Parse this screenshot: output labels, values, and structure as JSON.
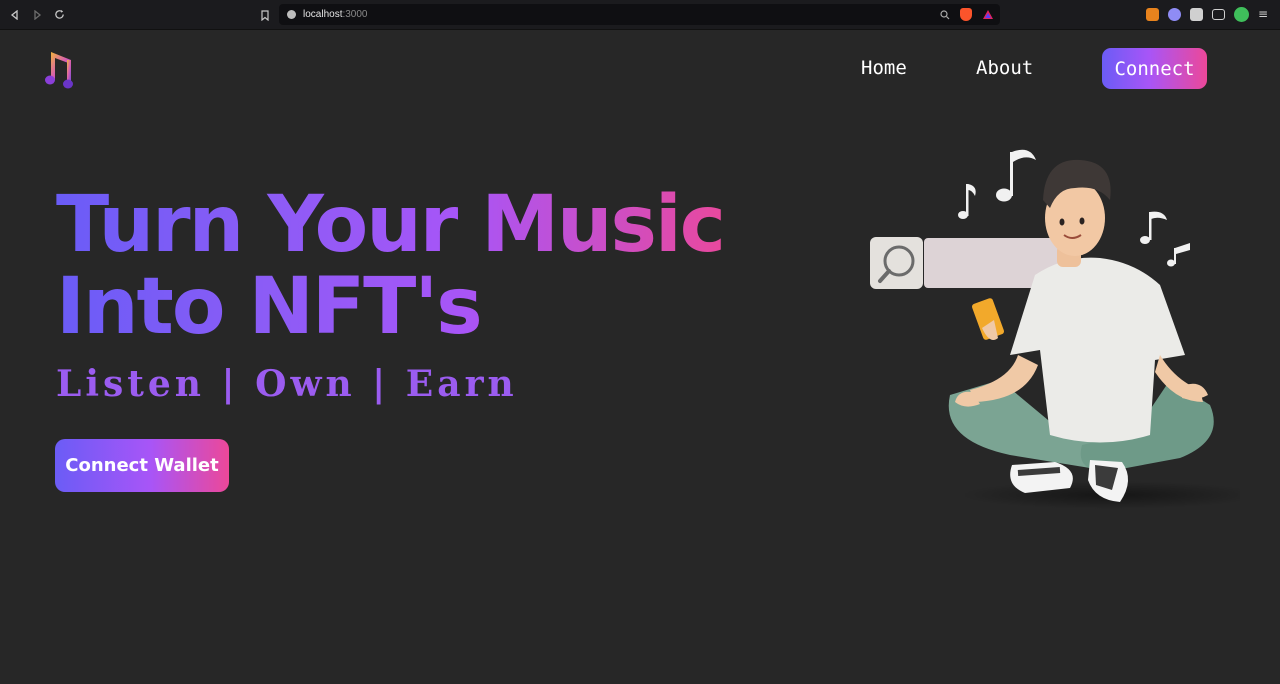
{
  "browser": {
    "url_host": "localhost",
    "url_port": ":3000"
  },
  "nav": {
    "home": "Home",
    "about": "About",
    "connect": "Connect"
  },
  "hero": {
    "title_line1": "Turn Your Music",
    "title_line2": "Into NFT's",
    "tagline": "Listen | Own | Earn",
    "cta": "Connect Wallet"
  },
  "colors": {
    "background": "#272727",
    "gradient_start": "#6b5cf6",
    "gradient_mid": "#a855f7",
    "gradient_end": "#ec4899"
  },
  "icons": {
    "logo": "music-note-icon",
    "search": "magnifier-icon"
  }
}
